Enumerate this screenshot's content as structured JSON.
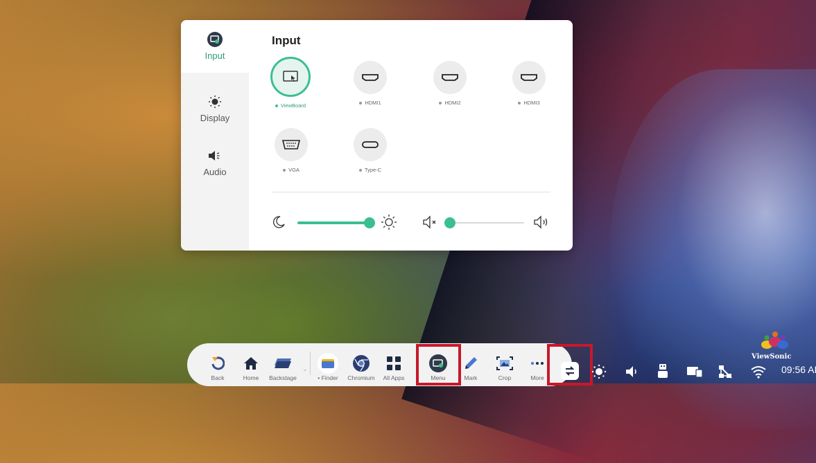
{
  "panel": {
    "title": "Input",
    "sidebar": [
      {
        "label": "Input",
        "icon": "input-source-icon",
        "active": true
      },
      {
        "label": "Display",
        "icon": "brightness-icon",
        "active": false
      },
      {
        "label": "Audio",
        "icon": "speaker-icon",
        "active": false
      }
    ],
    "sources": [
      {
        "label": "ViewBoard",
        "icon": "viewboard-icon",
        "selected": true
      },
      {
        "label": "HDMI1",
        "icon": "hdmi-port-icon",
        "selected": false
      },
      {
        "label": "HDMI2",
        "icon": "hdmi-port-icon",
        "selected": false
      },
      {
        "label": "HDMI3",
        "icon": "hdmi-port-icon",
        "selected": false
      },
      {
        "label": "VGA",
        "icon": "vga-port-icon",
        "selected": false
      },
      {
        "label": "Type-C",
        "icon": "usb-c-port-icon",
        "selected": false
      }
    ],
    "brightness_level": 1.0,
    "volume_level": 0.0
  },
  "taskbar": {
    "items": [
      {
        "label": "Back",
        "icon": "back-icon"
      },
      {
        "label": "Home",
        "icon": "home-icon"
      },
      {
        "label": "Backstage",
        "icon": "backstage-icon"
      },
      {
        "label": "• Finder",
        "icon": "folder-icon"
      },
      {
        "label": "Chromium",
        "icon": "chromium-icon"
      },
      {
        "label": "All Apps",
        "icon": "apps-grid-icon"
      },
      {
        "label": "Menu",
        "icon": "menu-icon"
      },
      {
        "label": "Mark",
        "icon": "pen-icon"
      },
      {
        "label": "Crop",
        "icon": "crop-icon"
      },
      {
        "label": "More",
        "icon": "more-icon"
      }
    ]
  },
  "tray": {
    "time": "09:56 AI",
    "brand": "ViewSonic"
  },
  "colors": {
    "accent": "#3bbf8f",
    "highlight": "#c8182a"
  }
}
